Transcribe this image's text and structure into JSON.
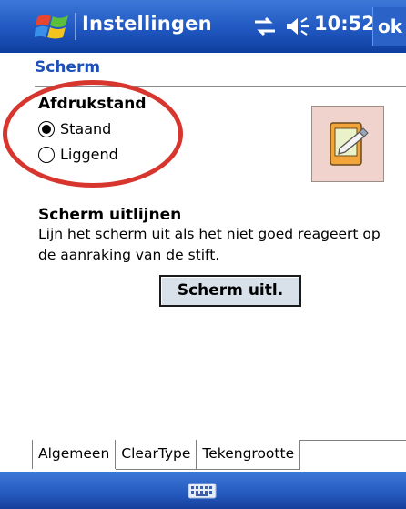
{
  "titlebar": {
    "title": "Instellingen",
    "time": "10:52",
    "ok_label": "ok",
    "icons": [
      "windows-start-icon",
      "connectivity-icon",
      "volume-icon"
    ]
  },
  "page": {
    "title": "Scherm"
  },
  "orientation": {
    "heading": "Afdrukstand",
    "options": [
      {
        "label": "Staand",
        "selected": true
      },
      {
        "label": "Liggend",
        "selected": false
      }
    ]
  },
  "align": {
    "heading": "Scherm uitlijnen",
    "description": "Lijn het scherm uit als het niet goed reageert op de aanraking van de stift.",
    "button_label": "Scherm uitl."
  },
  "tabs": [
    {
      "label": "Algemeen",
      "active": true
    },
    {
      "label": "ClearType",
      "active": false
    },
    {
      "label": "Tekengrootte",
      "active": false
    }
  ],
  "menubar": {
    "icon": "keyboard-icon"
  },
  "colors": {
    "titlebar": "#2057c0",
    "accent_text": "#1c4fb8",
    "annotation": "#d7362f",
    "preview_bg": "#efd3cc"
  }
}
